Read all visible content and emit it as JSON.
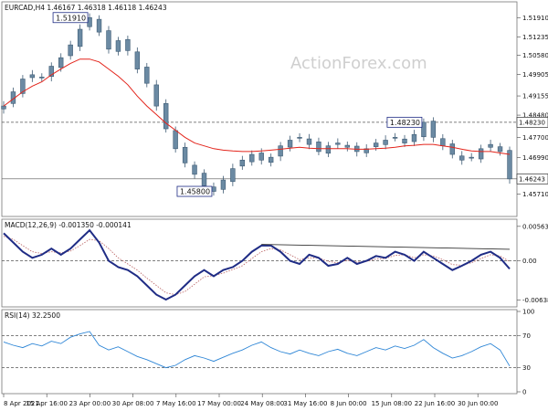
{
  "chart_data": {
    "type": "line",
    "watermark": "ActionForex.com",
    "x_ticks": [
      "8 Apr 2021",
      "15 Apr 16:00",
      "23 Apr 00:00",
      "30 Apr 08:00",
      "7 May 16:00",
      "17 May 00:00",
      "24 May 08:00",
      "31 May 16:00",
      "8 Jun 00:00",
      "15 Jun 08:00",
      "22 Jun 16:00",
      "30 Jun 00:00"
    ],
    "panels": [
      {
        "id": "price",
        "title": "EURCAD,H4  1.46167 1.46318 1.46118 1.46243",
        "ylim": [
          1.4495,
          1.524
        ],
        "y_ticks": [
          "1.51910",
          "1.51235",
          "1.50580",
          "1.49905",
          "1.49155",
          "1.48480",
          "1.47700",
          "1.46990",
          "1.46330",
          "1.45710"
        ],
        "series": [
          {
            "type": "candles",
            "color": "#3d5a73",
            "values": [
              1.488,
              1.493,
              1.4975,
              1.499,
              1.498,
              1.502,
              1.505,
              1.5095,
              1.515,
              1.5191,
              1.514,
              1.508,
              1.511,
              1.5075,
              1.501,
              1.496,
              1.488,
              1.48,
              1.473,
              1.468,
              1.464,
              1.46,
              1.458,
              1.462,
              1.466,
              1.469,
              1.471,
              1.469,
              1.47,
              1.474,
              1.476,
              1.477,
              1.4745,
              1.472,
              1.474,
              1.475,
              1.4735,
              1.472,
              1.473,
              1.475,
              1.476,
              1.477,
              1.475,
              1.478,
              1.4823,
              1.477,
              1.474,
              1.471,
              1.469,
              1.47,
              1.473,
              1.4745,
              1.472,
              1.4624
            ]
          },
          {
            "type": "line",
            "color": "#e3241b",
            "values": [
              1.488,
              1.4905,
              1.493,
              1.495,
              1.4965,
              1.499,
              1.501,
              1.503,
              1.5045,
              1.5045,
              1.5035,
              1.501,
              1.4985,
              1.4955,
              1.4915,
              1.488,
              1.485,
              1.482,
              1.4795,
              1.477,
              1.475,
              1.474,
              1.473,
              1.4725,
              1.4722,
              1.472,
              1.472,
              1.4722,
              1.4725,
              1.4728,
              1.4732,
              1.4735,
              1.4732,
              1.473,
              1.473,
              1.473,
              1.473,
              1.4728,
              1.4728,
              1.473,
              1.4732,
              1.4735,
              1.474,
              1.4742,
              1.4745,
              1.4745,
              1.474,
              1.4735,
              1.4728,
              1.4722,
              1.472,
              1.472,
              1.4715,
              1.471
            ]
          }
        ],
        "hlines": [
          {
            "y": 1.4823,
            "style": "dashed"
          },
          {
            "y": 1.4624,
            "style": "solid"
          }
        ],
        "annotations": [
          {
            "text": "1.51910",
            "x_index": 9,
            "y": 1.5191,
            "side": "left"
          },
          {
            "text": "1.45800",
            "x_index": 22,
            "y": 1.458,
            "side": "left"
          },
          {
            "text": "1.48230",
            "x_index": 44,
            "y": 1.4823,
            "side": "left"
          }
        ],
        "price_tags": [
          {
            "text": "1.48230",
            "y": 1.4823
          },
          {
            "text": "1.46243",
            "y": 1.4624
          }
        ]
      },
      {
        "id": "macd",
        "title": "MACD(12,26,9) -0.001350 -0.000141",
        "ylim": [
          -0.0072,
          0.0065
        ],
        "y_ticks": [
          "0.00563",
          "0.00",
          "-0.00638"
        ],
        "series": [
          {
            "type": "line",
            "name": "MACD",
            "color": "#1f2c85",
            "values": [
              0.0045,
              0.003,
              0.0015,
              0.0005,
              0.001,
              0.002,
              0.001,
              0.002,
              0.0035,
              0.005,
              0.003,
              0.0,
              -0.001,
              -0.0015,
              -0.0025,
              -0.004,
              -0.0055,
              -0.0063,
              -0.0055,
              -0.004,
              -0.0025,
              -0.0015,
              -0.0025,
              -0.0015,
              -0.001,
              0.0,
              0.0015,
              0.0025,
              0.0025,
              0.0015,
              0.0,
              -0.0005,
              0.001,
              0.0005,
              -0.0008,
              -0.0005,
              0.0005,
              -0.0005,
              0.0,
              0.0008,
              0.0005,
              0.0015,
              0.001,
              0.0,
              0.0015,
              0.0005,
              -0.0005,
              -0.0015,
              -0.0008,
              0.0,
              0.001,
              0.0015,
              0.0005,
              -0.0013
            ]
          },
          {
            "type": "line",
            "name": "Signal",
            "color": "#b86060",
            "style": "dotted",
            "values": [
              0.004,
              0.0035,
              0.0025,
              0.0015,
              0.0012,
              0.0015,
              0.0013,
              0.0016,
              0.0025,
              0.0035,
              0.0033,
              0.002,
              0.0005,
              -0.0005,
              -0.0015,
              -0.0028,
              -0.004,
              -0.0052,
              -0.0055,
              -0.005,
              -0.0038,
              -0.0026,
              -0.0024,
              -0.002,
              -0.0014,
              -0.0008,
              0.0004,
              0.0015,
              0.002,
              0.0018,
              0.001,
              0.0002,
              0.0005,
              0.0005,
              -0.0001,
              -0.0003,
              0.0001,
              -0.0002,
              -0.0001,
              0.0003,
              0.0004,
              0.0009,
              0.001,
              0.0005,
              0.001,
              0.0008,
              0.0002,
              -0.0006,
              -0.0007,
              -0.0003,
              0.0004,
              0.001,
              0.0008,
              -0.0001
            ]
          }
        ],
        "hlines": [
          {
            "y": 0.0,
            "style": "dashed"
          }
        ],
        "trendline": {
          "from": [
            27,
            0.0027
          ],
          "to": [
            53,
            0.0019
          ]
        }
      },
      {
        "id": "rsi",
        "title": "RSI(14) 32.2500",
        "ylim": [
          0,
          100
        ],
        "y_ticks": [
          "100",
          "70",
          "30",
          "0"
        ],
        "series": [
          {
            "type": "line",
            "name": "RSI",
            "color": "#2e86d6",
            "values": [
              62,
              58,
              55,
              60,
              57,
              63,
              60,
              68,
              72,
              75,
              58,
              52,
              56,
              50,
              44,
              40,
              35,
              30,
              33,
              40,
              45,
              42,
              38,
              43,
              48,
              52,
              58,
              62,
              55,
              50,
              47,
              52,
              48,
              45,
              50,
              53,
              48,
              45,
              50,
              55,
              52,
              57,
              54,
              58,
              65,
              55,
              48,
              42,
              45,
              50,
              56,
              60,
              52,
              32
            ]
          }
        ],
        "hlines": [
          {
            "y": 70,
            "style": "dashed"
          },
          {
            "y": 30,
            "style": "dashed"
          }
        ]
      }
    ]
  }
}
